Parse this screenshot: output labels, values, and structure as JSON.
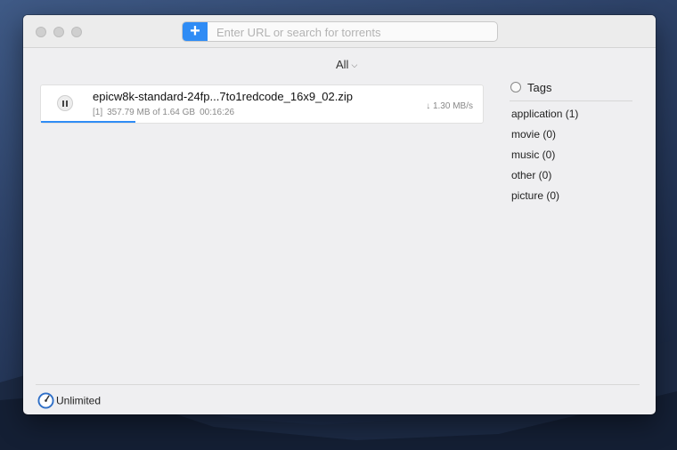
{
  "toolbar": {
    "add_label": "+",
    "search_placeholder": "Enter URL or search for torrents"
  },
  "filter": {
    "selected": "All",
    "chevron_icon": "chevron-down-icon"
  },
  "torrents": [
    {
      "name": "epicw8k-standard-24fp...7to1redcode_16x9_02.zip",
      "index": "[1]",
      "downloaded": "357.79 MB of 1.64 GB",
      "eta": "00:16:26",
      "speed": "↓ 1.30 MB/s",
      "progress": 0.2133,
      "state_icon": "pause-icon"
    }
  ],
  "tags": {
    "title": "Tags",
    "items": [
      {
        "label": "application (1)"
      },
      {
        "label": "movie (0)"
      },
      {
        "label": "music (0)"
      },
      {
        "label": "other (0)"
      },
      {
        "label": "picture (0)"
      }
    ]
  },
  "status": {
    "speed_limit": "Unlimited",
    "icon": "speed-gauge-icon"
  },
  "colors": {
    "accent": "#2f8cf5",
    "window_bg": "#efeff1"
  }
}
